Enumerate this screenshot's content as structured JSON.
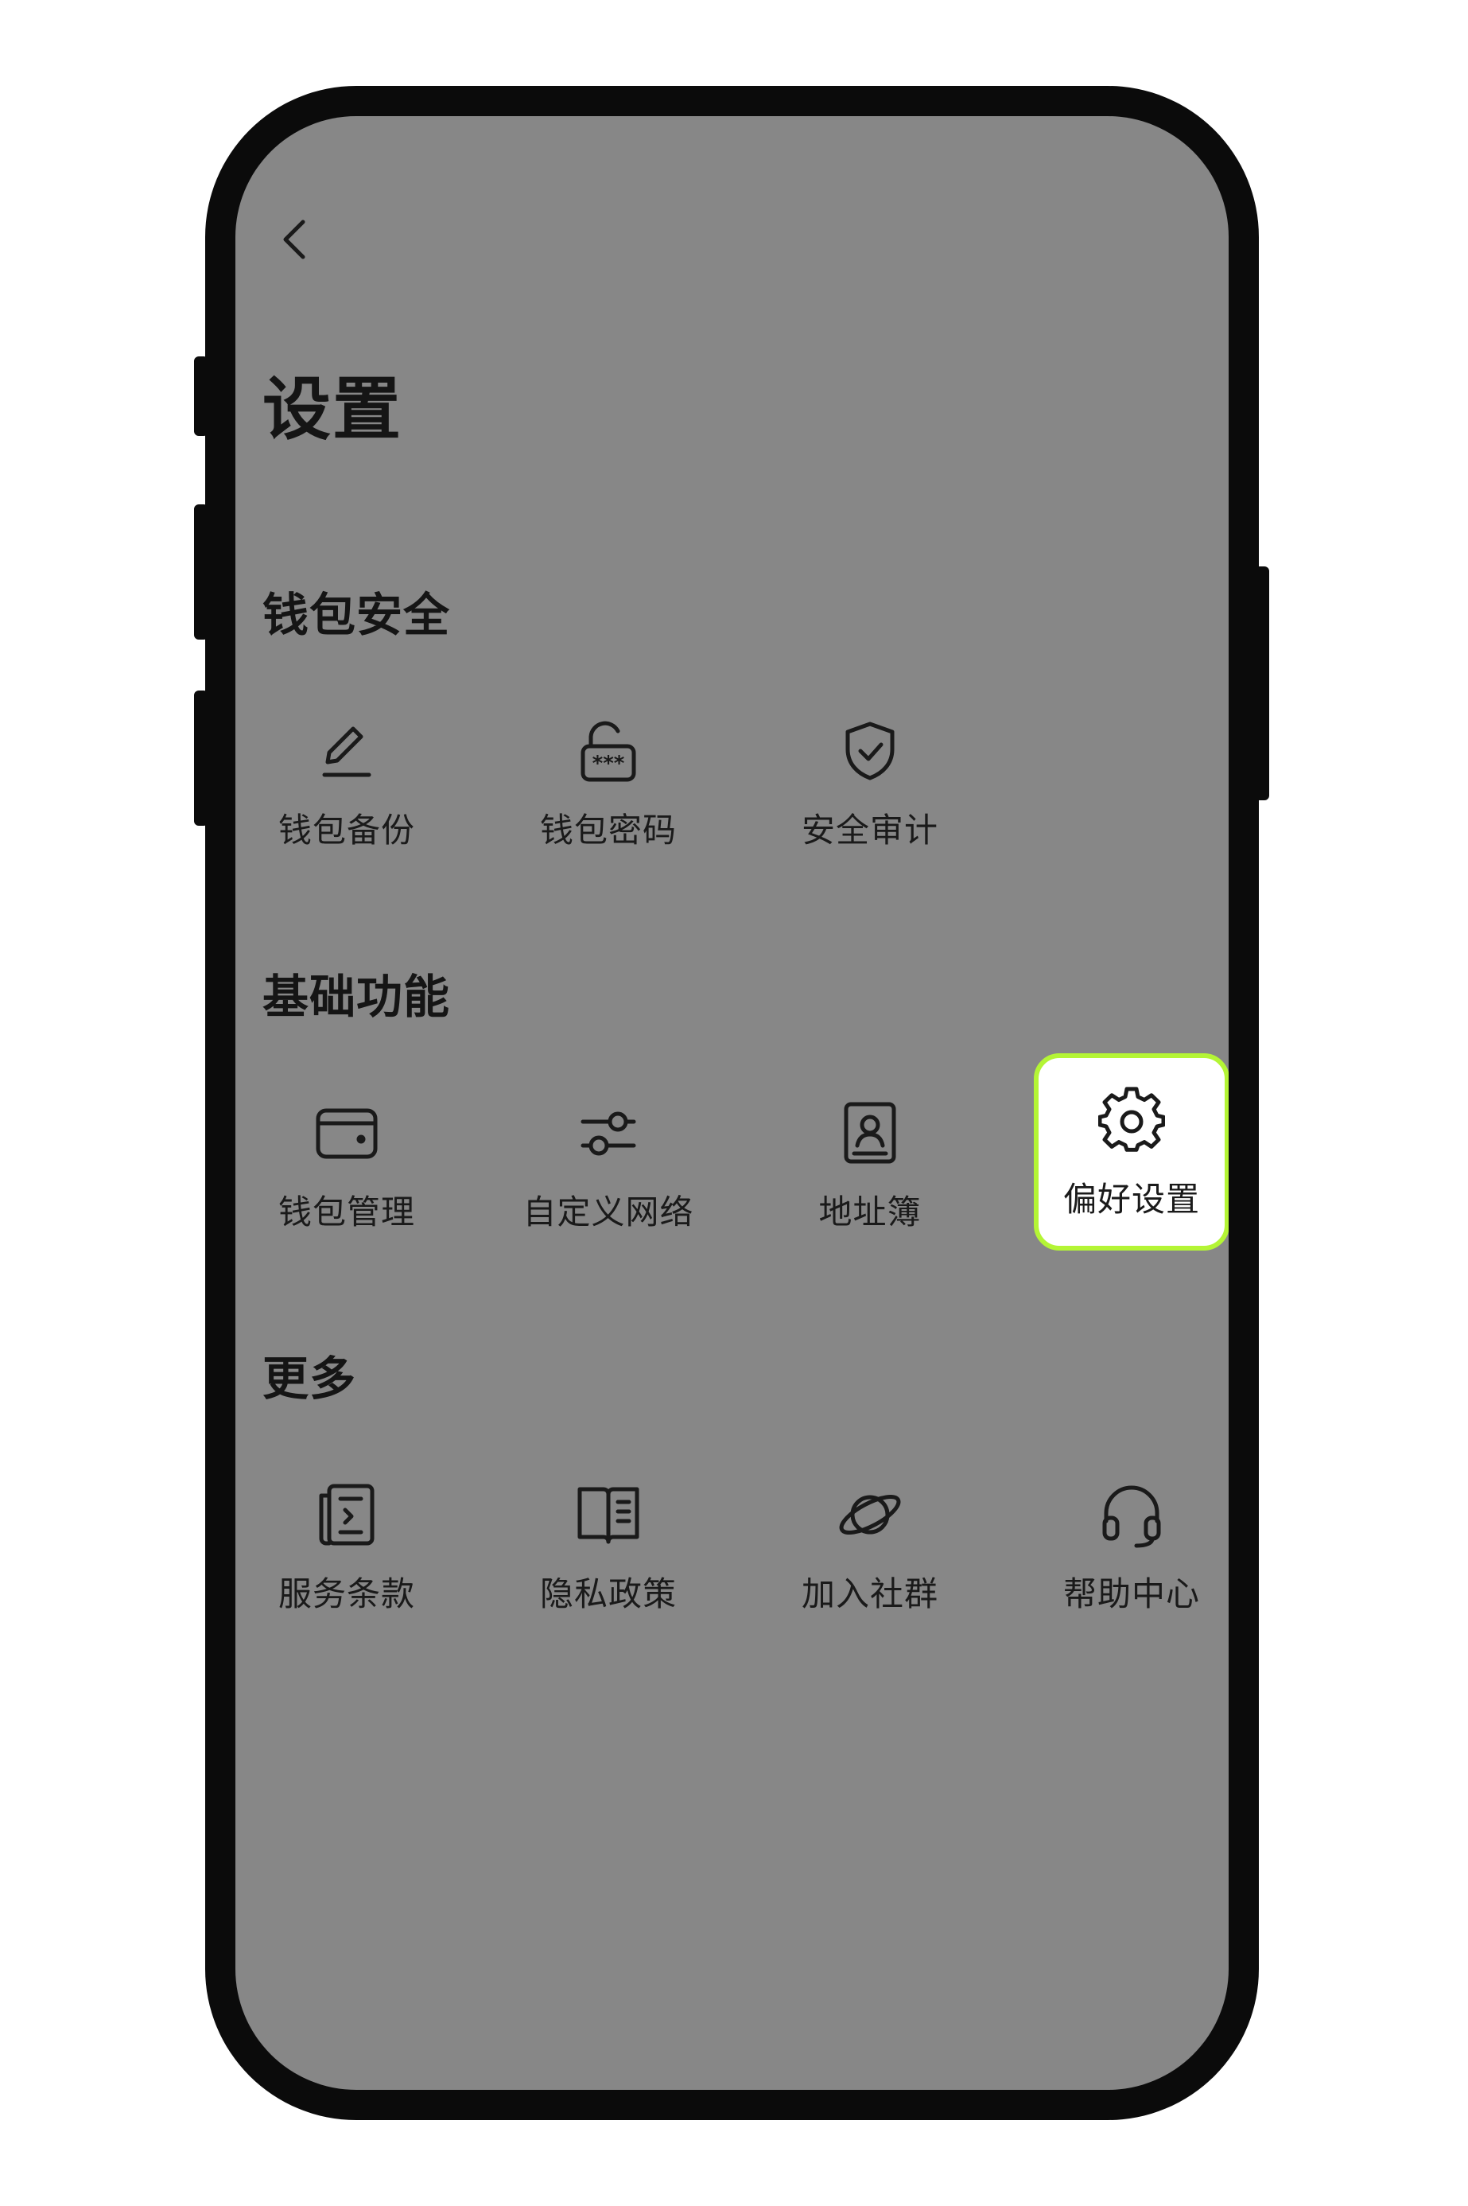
{
  "page": {
    "title": "设置"
  },
  "sections": [
    {
      "title": "钱包安全",
      "items": [
        {
          "label": "钱包备份",
          "icon": "pencil-icon"
        },
        {
          "label": "钱包密码",
          "icon": "unlocked-padlock-icon"
        },
        {
          "label": "安全审计",
          "icon": "shield-check-icon"
        }
      ]
    },
    {
      "title": "基础功能",
      "items": [
        {
          "label": "钱包管理",
          "icon": "wallet-icon"
        },
        {
          "label": "自定义网络",
          "icon": "sliders-icon"
        },
        {
          "label": "地址簿",
          "icon": "contact-book-icon"
        },
        {
          "label": "偏好设置",
          "icon": "gear-icon",
          "highlighted": true
        }
      ]
    },
    {
      "title": "更多",
      "items": [
        {
          "label": "服务条款",
          "icon": "document-icon"
        },
        {
          "label": "隐私政策",
          "icon": "open-book-icon"
        },
        {
          "label": "加入社群",
          "icon": "planet-icon"
        },
        {
          "label": "帮助中心",
          "icon": "headset-icon"
        }
      ]
    }
  ],
  "colors": {
    "screen_background": "#878787",
    "highlight_border": "#b4f535",
    "highlight_fill": "#ffffff",
    "text": "#151515"
  }
}
